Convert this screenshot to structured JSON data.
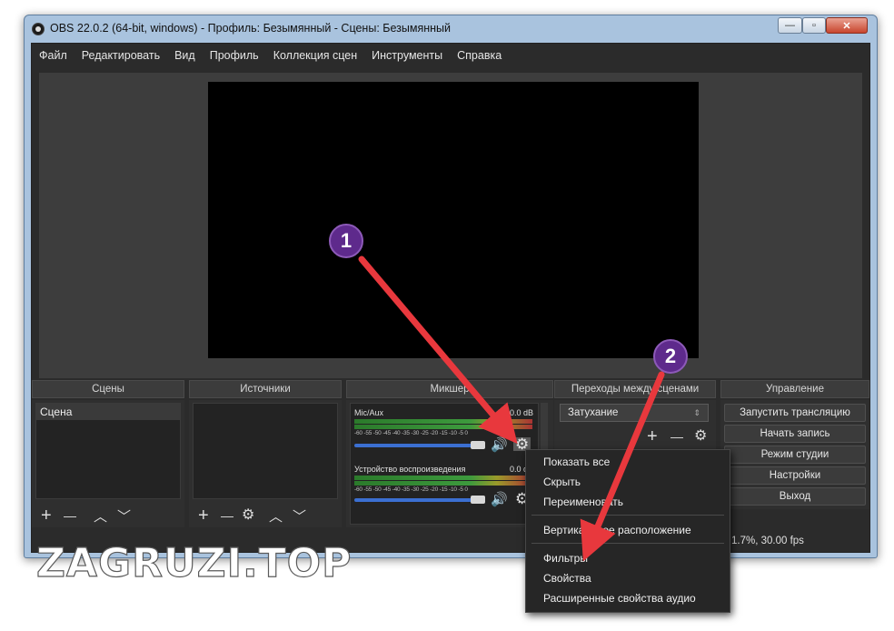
{
  "window": {
    "title": "OBS 22.0.2 (64-bit, windows) - Профиль: Безымянный - Сцены: Безымянный",
    "controls": {
      "minimize": "—",
      "maximize": "▫",
      "close": "✕"
    }
  },
  "menu": [
    "Файл",
    "Редактировать",
    "Вид",
    "Профиль",
    "Коллекция сцен",
    "Инструменты",
    "Справка"
  ],
  "docks": {
    "scenes": {
      "title": "Сцены",
      "items": [
        "Сцена"
      ]
    },
    "sources": {
      "title": "Источники"
    },
    "mixer": {
      "title": "Микшер",
      "channels": [
        {
          "name": "Mic/Aux",
          "db": "0.0 dB",
          "volume_fraction": 1.0
        },
        {
          "name": "Устройство воспроизведения",
          "db": "0.0 dB",
          "volume_fraction": 1.0
        }
      ],
      "scale": "-60 -55 -50 -45 -40 -35 -30 -25 -20 -15 -10 -5 0"
    },
    "transitions": {
      "title": "Переходы между сценами",
      "selected": "Затухание"
    },
    "controls": {
      "title": "Управление",
      "buttons": [
        "Запустить трансляцию",
        "Начать запись",
        "Режим студии",
        "Настройки",
        "Выход"
      ]
    }
  },
  "toolbar_glyphs": {
    "add": "+",
    "remove": "—",
    "up": "︿",
    "down": "﹀",
    "gear": "⚙",
    "speaker": "🔊"
  },
  "status": {
    "text": "1.7%, 30.00 fps"
  },
  "context_menu": {
    "items": [
      "Показать все",
      "Скрыть",
      "Переименовать",
      "Вертикальное расположение",
      "Фильтры",
      "Свойства",
      "Расширенные свойства аудио"
    ]
  },
  "annotations": {
    "marker_1": "1",
    "marker_2": "2",
    "arrow_color": "#e8383d",
    "marker_color": "#5e2a8c"
  },
  "watermark": "ZAGRUZI.TOP"
}
